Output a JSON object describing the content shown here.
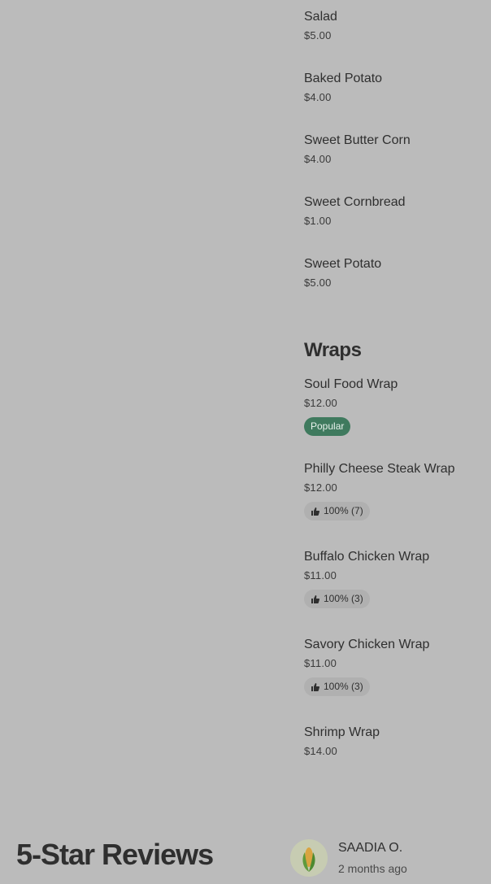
{
  "menu_items_top": [
    {
      "name": "Salad",
      "price": "$5.00"
    },
    {
      "name": "Baked Potato",
      "price": "$4.00"
    },
    {
      "name": "Sweet Butter Corn",
      "price": "$4.00"
    },
    {
      "name": "Sweet Cornbread",
      "price": "$1.00"
    },
    {
      "name": "Sweet Potato",
      "price": "$5.00"
    }
  ],
  "wraps": {
    "title": "Wraps",
    "items": [
      {
        "name": "Soul Food Wrap",
        "price": "$12.00",
        "badge": "Popular"
      },
      {
        "name": "Philly Cheese Steak Wrap",
        "price": "$12.00",
        "rating": "100% (7)"
      },
      {
        "name": "Buffalo Chicken Wrap",
        "price": "$11.00",
        "rating": "100% (3)"
      },
      {
        "name": "Savory Chicken Wrap",
        "price": "$11.00",
        "rating": "100% (3)"
      },
      {
        "name": "Shrimp Wrap",
        "price": "$14.00"
      }
    ]
  },
  "reviews": {
    "title": "5-Star Reviews",
    "first": {
      "name": "SAADIA O.",
      "time": "2 months ago",
      "avatar_icon": "corn-icon"
    }
  },
  "colors": {
    "background": "#bbbbbb",
    "popular_badge": "#3f7a5e"
  }
}
